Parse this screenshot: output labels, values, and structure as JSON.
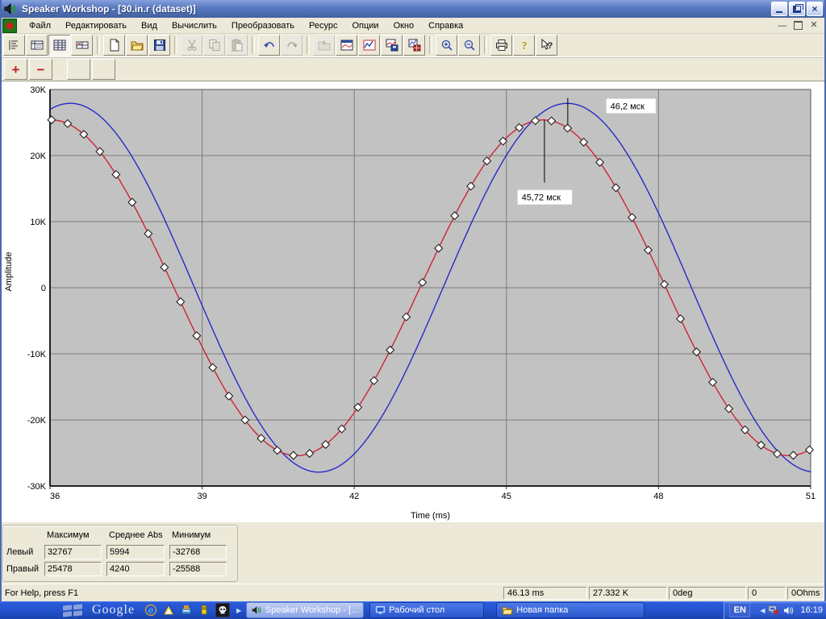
{
  "window": {
    "title": "Speaker Workshop - [30.in.r (dataset)]"
  },
  "menu": {
    "items": [
      "Файл",
      "Редактировать",
      "Вид",
      "Вычислить",
      "Преобразовать",
      "Ресурс",
      "Опции",
      "Окно",
      "Справка"
    ]
  },
  "toolbar": {
    "buttons": [
      "notes-view",
      "datasheet-small",
      "datasheet-grid",
      "datasheet-wide",
      "new-document",
      "open-file",
      "save-file",
      "cut",
      "copy",
      "paste",
      "undo",
      "redo",
      "import-folder",
      "chart-window",
      "chart-compare",
      "chart-save",
      "chart-export",
      "zoom-in",
      "zoom-out",
      "print",
      "help-about",
      "context-help"
    ],
    "toolbar2_buttons": [
      "add-point",
      "remove-point",
      "blank-1",
      "blank-2"
    ]
  },
  "chart_data": {
    "type": "line",
    "title": "",
    "xlabel": "Time (ms)",
    "ylabel": "Amplitude",
    "xlim": [
      36,
      51
    ],
    "xticks": [
      36,
      39,
      42,
      45,
      48,
      51
    ],
    "ylim": [
      -30000,
      30000
    ],
    "yticks": [
      30000,
      20000,
      10000,
      0,
      -10000,
      -20000,
      -30000
    ],
    "ytick_labels": [
      "30K",
      "20K",
      "10K",
      "0",
      "-10K",
      "-20K",
      "-30K"
    ],
    "grid": true,
    "plot_bg": "#c2c2c2",
    "grid_color": "#7c7c7c",
    "series": [
      {
        "name": "left-channel",
        "color": "#2a2ac8",
        "waveform": "sine",
        "amplitude": 27900,
        "period_ms": 9.8,
        "peak_ms": 46.2,
        "markers": false
      },
      {
        "name": "right-channel",
        "color": "#cf2535",
        "waveform": "sine",
        "amplitude": 25400,
        "period_ms": 9.7,
        "peak_ms": 45.72,
        "markers": true,
        "marker_start_ms": 36.03,
        "marker_step_ms": 0.318,
        "marker_shape": "diamond"
      }
    ],
    "annotations": [
      {
        "text": "46,2 мск",
        "line_ms": 46.21,
        "line_v_from": 28700,
        "line_v_to": 24600,
        "label_ms": 46.97,
        "label_v": 28600
      },
      {
        "text": "45,72 мск",
        "line_ms": 45.75,
        "line_v_from": 25400,
        "line_v_to": 15900,
        "label_ms": 45.22,
        "label_v": 14800
      }
    ]
  },
  "stats": {
    "headers": [
      "Максимум",
      "Среднее Abs",
      "Минимум"
    ],
    "rows": [
      {
        "label": "Левый",
        "values": [
          "32767",
          "5994",
          "-32768"
        ]
      },
      {
        "label": "Правый",
        "values": [
          "25478",
          "4240",
          "-25588"
        ]
      }
    ]
  },
  "statusbar": {
    "message": "For Help, press F1",
    "panes": [
      "46.13  ms",
      "27.332 K",
      "0deg",
      "0",
      "0Ohms"
    ]
  },
  "taskbar": {
    "google_label": "Google",
    "quick_launch_icons": [
      "ie-icon",
      "delta-icon",
      "hand-icon",
      "robot-icon",
      "skull-icon"
    ],
    "buttons": [
      {
        "label": "Speaker Workshop - [...",
        "active": true
      },
      {
        "label": "Рабочий стол",
        "active": false
      },
      {
        "label": "Новая папка",
        "active": false
      }
    ],
    "tray": {
      "lang": "EN",
      "time": "16:19",
      "icons": [
        "network-icon",
        "volume-icon"
      ]
    }
  }
}
